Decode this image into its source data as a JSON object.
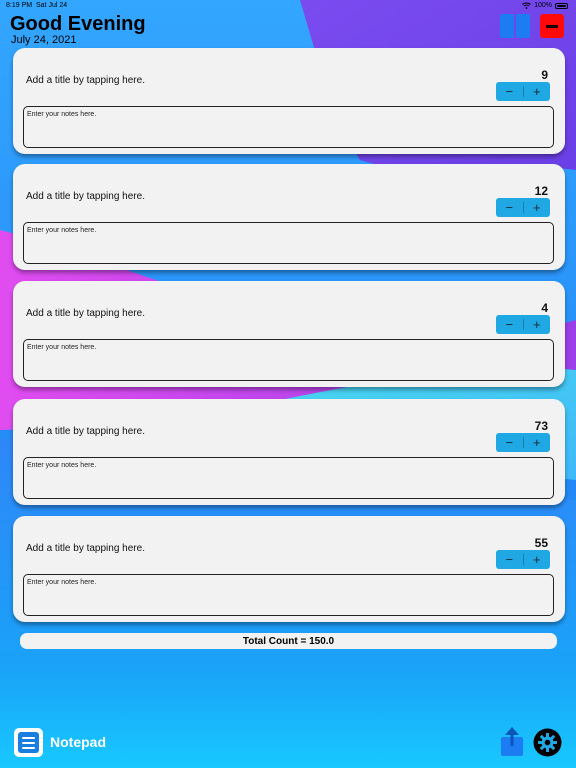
{
  "status": {
    "time": "8:19 PM",
    "date": "Sat Jul 24",
    "battery": "100%"
  },
  "header": {
    "greeting": "Good Evening",
    "date": "July 24, 2021"
  },
  "notes": [
    {
      "title_placeholder": "Add a title by tapping here.",
      "count": "9",
      "notes_placeholder": "Enter your notes here.",
      "minus": "−",
      "plus": "+"
    },
    {
      "title_placeholder": "Add a title by tapping here.",
      "count": "12",
      "notes_placeholder": "Enter your notes here.",
      "minus": "−",
      "plus": "+"
    },
    {
      "title_placeholder": "Add a title by tapping here.",
      "count": "4",
      "notes_placeholder": "Enter your notes here.",
      "minus": "−",
      "plus": "+"
    },
    {
      "title_placeholder": "Add a title by tapping here.",
      "count": "73",
      "notes_placeholder": "Enter your notes here.",
      "minus": "−",
      "plus": "+"
    },
    {
      "title_placeholder": "Add a title by tapping here.",
      "count": "55",
      "notes_placeholder": "Enter your notes here.",
      "minus": "−",
      "plus": "+"
    }
  ],
  "total": {
    "label": "Total Count = 150.0"
  },
  "footer": {
    "app_name": "Notepad",
    "app_icon": "notepad-icon",
    "share_icon": "share-icon",
    "settings_icon": "gear-icon"
  },
  "colors": {
    "accent_blue": "#1fa8e4",
    "layout_button": "#1e7cf2",
    "delete_red": "#ff0a0a",
    "card_bg": "#f2f2f2"
  }
}
